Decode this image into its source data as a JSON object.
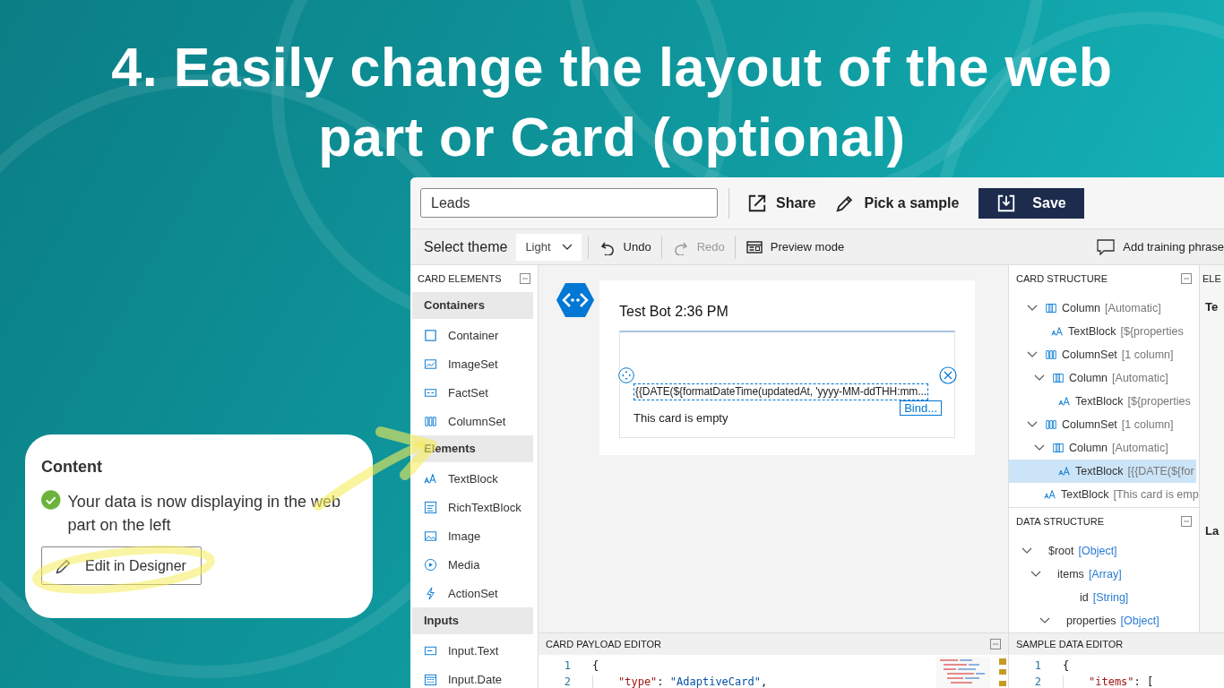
{
  "slide": {
    "title": "4. Easily change the layout of the web part or Card (optional)"
  },
  "designer": {
    "toolbar": {
      "name_field": {
        "value": "Leads"
      },
      "buttons": [
        {
          "label": "Share",
          "kind": "share"
        },
        {
          "label": "Pick a sample",
          "kind": "sample"
        },
        {
          "label": "Save",
          "kind": "save"
        }
      ]
    },
    "secondary_toolbar": {
      "theme_label": "Select theme",
      "theme_value": "Light",
      "items": [
        {
          "label": "Undo",
          "kind": "undo",
          "disabled": false
        },
        {
          "label": "Redo",
          "kind": "redo",
          "disabled": true
        },
        {
          "label": "Preview mode",
          "kind": "preview",
          "disabled": false
        }
      ],
      "training": "Add training phrase"
    },
    "card_elements": {
      "title": "CARD ELEMENTS",
      "groups": [
        {
          "name": "Containers",
          "items": [
            {
              "label": "Container",
              "kind": "container"
            },
            {
              "label": "ImageSet",
              "kind": "imageset"
            },
            {
              "label": "FactSet",
              "kind": "factset"
            },
            {
              "label": "ColumnSet",
              "kind": "columnset"
            }
          ]
        },
        {
          "name": "Elements",
          "items": [
            {
              "label": "TextBlock",
              "kind": "textblock"
            },
            {
              "label": "RichTextBlock",
              "kind": "richtextblock"
            },
            {
              "label": "Image",
              "kind": "image"
            },
            {
              "label": "Media",
              "kind": "media"
            },
            {
              "label": "ActionSet",
              "kind": "actionset"
            }
          ]
        },
        {
          "name": "Inputs",
          "items": [
            {
              "label": "Input.Text",
              "kind": "inputtext"
            },
            {
              "label": "Input.Date",
              "kind": "inputdate"
            }
          ]
        }
      ]
    },
    "canvas": {
      "card_header": "Test Bot 2:36 PM",
      "selected_text": "{{DATE(${formatDateTime(updatedAt, 'yyyy-MM-ddTHH:mm...",
      "bind_button": "Bind...",
      "empty_text": "This card is empty"
    },
    "card_structure": {
      "title": "CARD STRUCTURE",
      "tree": [
        {
          "label": "Column",
          "detail": "[Automatic]",
          "kind": "column",
          "expanded": true,
          "selected": false,
          "children": [
            {
              "label": "TextBlock",
              "detail": "[${properties",
              "kind": "textblock",
              "selected": false
            }
          ]
        },
        {
          "label": "ColumnSet",
          "detail": "[1 column]",
          "kind": "columnset",
          "expanded": true,
          "selected": false,
          "children": [
            {
              "label": "Column",
              "detail": "[Automatic]",
              "kind": "column",
              "expanded": true,
              "selected": false,
              "children": [
                {
                  "label": "TextBlock",
                  "detail": "[${properties",
                  "kind": "textblock",
                  "selected": false
                }
              ]
            }
          ]
        },
        {
          "label": "ColumnSet",
          "detail": "[1 column]",
          "kind": "columnset",
          "expanded": true,
          "selected": false,
          "children": [
            {
              "label": "Column",
              "detail": "[Automatic]",
              "kind": "column",
              "expanded": true,
              "selected": false,
              "children": [
                {
                  "label": "TextBlock",
                  "detail": "[{{DATE(${for",
                  "kind": "textblock",
                  "selected": true
                }
              ]
            }
          ]
        },
        {
          "label": "TextBlock",
          "detail": "[This card is emp",
          "kind": "textblock",
          "selected": false
        }
      ]
    },
    "data_structure": {
      "title": "DATA STRUCTURE",
      "tree": [
        {
          "label": "$root",
          "detail": "[Object]",
          "expanded": true,
          "children": [
            {
              "label": "items",
              "detail": "[Array]",
              "expanded": true,
              "children": [
                {
                  "label": "id",
                  "detail": "[String]"
                },
                {
                  "label": "properties",
                  "detail": "[Object]",
                  "expanded": true
                }
              ]
            }
          ]
        }
      ]
    },
    "element_properties": {
      "title": "ELE",
      "labels": [
        "Te",
        "La"
      ]
    },
    "payload_editor": {
      "title": "CARD PAYLOAD EDITOR",
      "lines": [
        {
          "number": "1",
          "tokens": [
            {
              "text": "{",
              "kind": "punct"
            }
          ]
        },
        {
          "number": "2",
          "tokens": [
            {
              "text": "\"type\"",
              "kind": "key"
            },
            {
              "text": ": ",
              "kind": "punct"
            },
            {
              "text": "\"AdaptiveCard\"",
              "kind": "value"
            },
            {
              "text": ",",
              "kind": "punct"
            }
          ]
        }
      ]
    },
    "sample_editor": {
      "title": "SAMPLE DATA EDITOR",
      "lines": [
        {
          "number": "1",
          "tokens": [
            {
              "text": "{",
              "kind": "punct"
            }
          ]
        },
        {
          "number": "2",
          "tokens": [
            {
              "text": "\"items\"",
              "kind": "key"
            },
            {
              "text": ": [",
              "kind": "punct"
            }
          ]
        }
      ]
    }
  },
  "callout": {
    "title": "Content",
    "status": {
      "ok": true,
      "text": "Your data is now displaying in the web part on the left"
    },
    "button": "Edit in Designer"
  }
}
